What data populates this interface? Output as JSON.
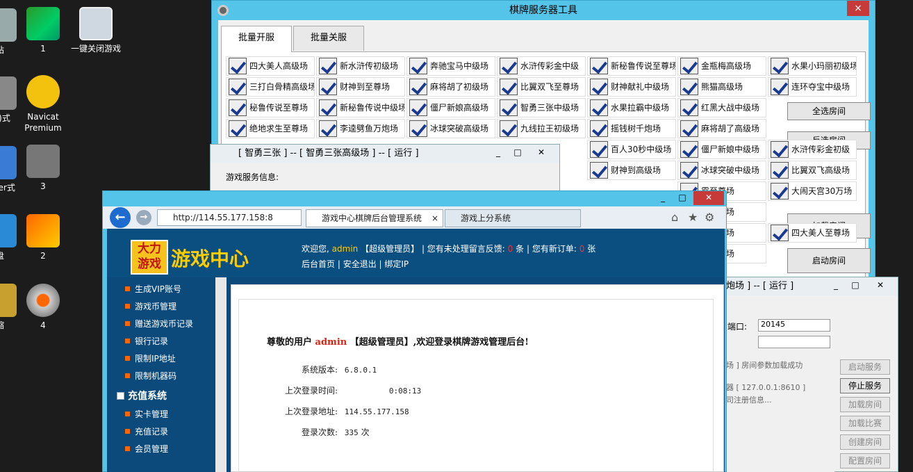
{
  "desktop": {
    "icons": [
      {
        "label": "站",
        "icon": "recycle-bin-icon"
      },
      {
        "label": "1",
        "icon": "app-green-icon"
      },
      {
        "label": "一键关闭游戏",
        "icon": "settings-app-icon"
      },
      {
        "label": "(C)式",
        "icon": "drive-icon"
      },
      {
        "label": "Navicat Premium",
        "icon": "navicat-icon"
      },
      {
        "label": "erver式",
        "icon": "server-icon"
      },
      {
        "label": "3",
        "icon": "tools-icon"
      },
      {
        "label": "盘",
        "icon": "disk-icon"
      },
      {
        "label": "2",
        "icon": "vs-icon"
      },
      {
        "label": "缩",
        "icon": "archive-icon"
      },
      {
        "label": "4",
        "icon": "gear-app-icon"
      }
    ]
  },
  "tool": {
    "title": "棋牌服务器工具",
    "close": "×",
    "tabs": [
      "批量开服",
      "批量关服"
    ],
    "rooms": [
      [
        "四大美人高级场",
        "新水浒传初级场",
        "奔驰宝马中级场",
        "水浒传彩金中级",
        "新秘鲁传说至尊场",
        "金瓶梅高级场",
        "水果小玛丽初级场"
      ],
      [
        "三打白骨精高级场",
        "财神到至尊场",
        "麻将胡了初级场",
        "比翼双飞至尊场",
        "财神献礼中级场",
        "熊猫高级场",
        "连环夺宝中级场"
      ],
      [
        "秘鲁传说至尊场",
        "新秘鲁传说中级场",
        "僵尸新娘高级场",
        "智勇三张中级场",
        "水果拉霸中级场",
        "红黑大战中级场",
        ""
      ],
      [
        "绝地求生至尊场",
        "李逵劈鱼万炮场",
        "冰球突破高级场",
        "九线拉王初级场",
        "摇钱树千炮场",
        "麻将胡了高级场",
        ""
      ],
      [
        "",
        "",
        "",
        "",
        "百人30秒中级场",
        "僵尸新娘中级场",
        "水浒传彩金初级"
      ],
      [
        "",
        "",
        "",
        "",
        "财神到高级场",
        "冰球突破中级场",
        "比翼双飞高级场"
      ],
      [
        "",
        "",
        "",
        "",
        "",
        "霸至尊场",
        "大闹天宫30万场"
      ],
      [
        "",
        "",
        "",
        "",
        "",
        "牛初级场",
        ""
      ],
      [
        "",
        "",
        "",
        "",
        "",
        "肖高级场",
        "四大美人至尊场"
      ],
      [
        "",
        "",
        "",
        "",
        "",
        "鱼千炮场",
        ""
      ]
    ],
    "side_buttons": {
      "select_all": "全选房间",
      "invert": "反选房间",
      "load": "加载房间",
      "start": "启动房间"
    }
  },
  "game_window": {
    "title": "[ 智勇三张 ] -- [ 智勇三张高级场 ] -- [ 运行 ]",
    "group": "游戏服务信息:"
  },
  "browser": {
    "url": "http://114.55.177.158:8",
    "tabs": [
      {
        "label": "游戏中心棋牌后台管理系统",
        "close": "×"
      },
      {
        "label": "游戏上分系统"
      }
    ],
    "logo_text": "大力游戏",
    "site_name": "游戏中心",
    "header": {
      "welcome": "欢迎您,",
      "user": "admin",
      "role": "【超级管理员】",
      "feedback_pre": "| 您有未处理留言反馈:",
      "feedback_count": "0",
      "feedback_unit": "条",
      "orders_pre": "| 您有新订单:",
      "orders_count": "0",
      "orders_unit": "张"
    },
    "links": [
      "后台首页",
      "安全退出",
      "绑定IP"
    ],
    "sidebar": {
      "items_top": [
        "生成VIP账号",
        "游戏币管理",
        "赠送游戏币记录",
        "银行记录",
        "限制IP地址",
        "限制机器码"
      ],
      "section": "充值系统",
      "items_bottom": [
        "实卡管理",
        "充值记录",
        "会员管理"
      ]
    },
    "main": {
      "greet_pre": "尊敬的用户",
      "greet_user": "admin",
      "greet_post": "【超级管理员】,欢迎登录棋牌游戏管理后台!",
      "version_label": "系统版本:",
      "version": "6.8.0.1",
      "last_time_label": "上次登录时间:",
      "last_time": "0:08:13",
      "last_addr_label": "上次登录地址:",
      "last_addr": "114.55.177.158",
      "count_label": "登录次数:",
      "count": "335",
      "count_unit": "次"
    }
  },
  "server_window": {
    "title": "炮场 ] -- [ 运行 ]",
    "port_label": "端口:",
    "port": "20145",
    "log": [
      "场 ] 房间参数加载成功",
      "器 [ 127.0.0.1:8610 ]",
      "司注册信息..."
    ],
    "buttons": [
      "启动服务",
      "停止服务",
      "加载房间",
      "加载比赛",
      "创建房间",
      "配置房间"
    ]
  }
}
